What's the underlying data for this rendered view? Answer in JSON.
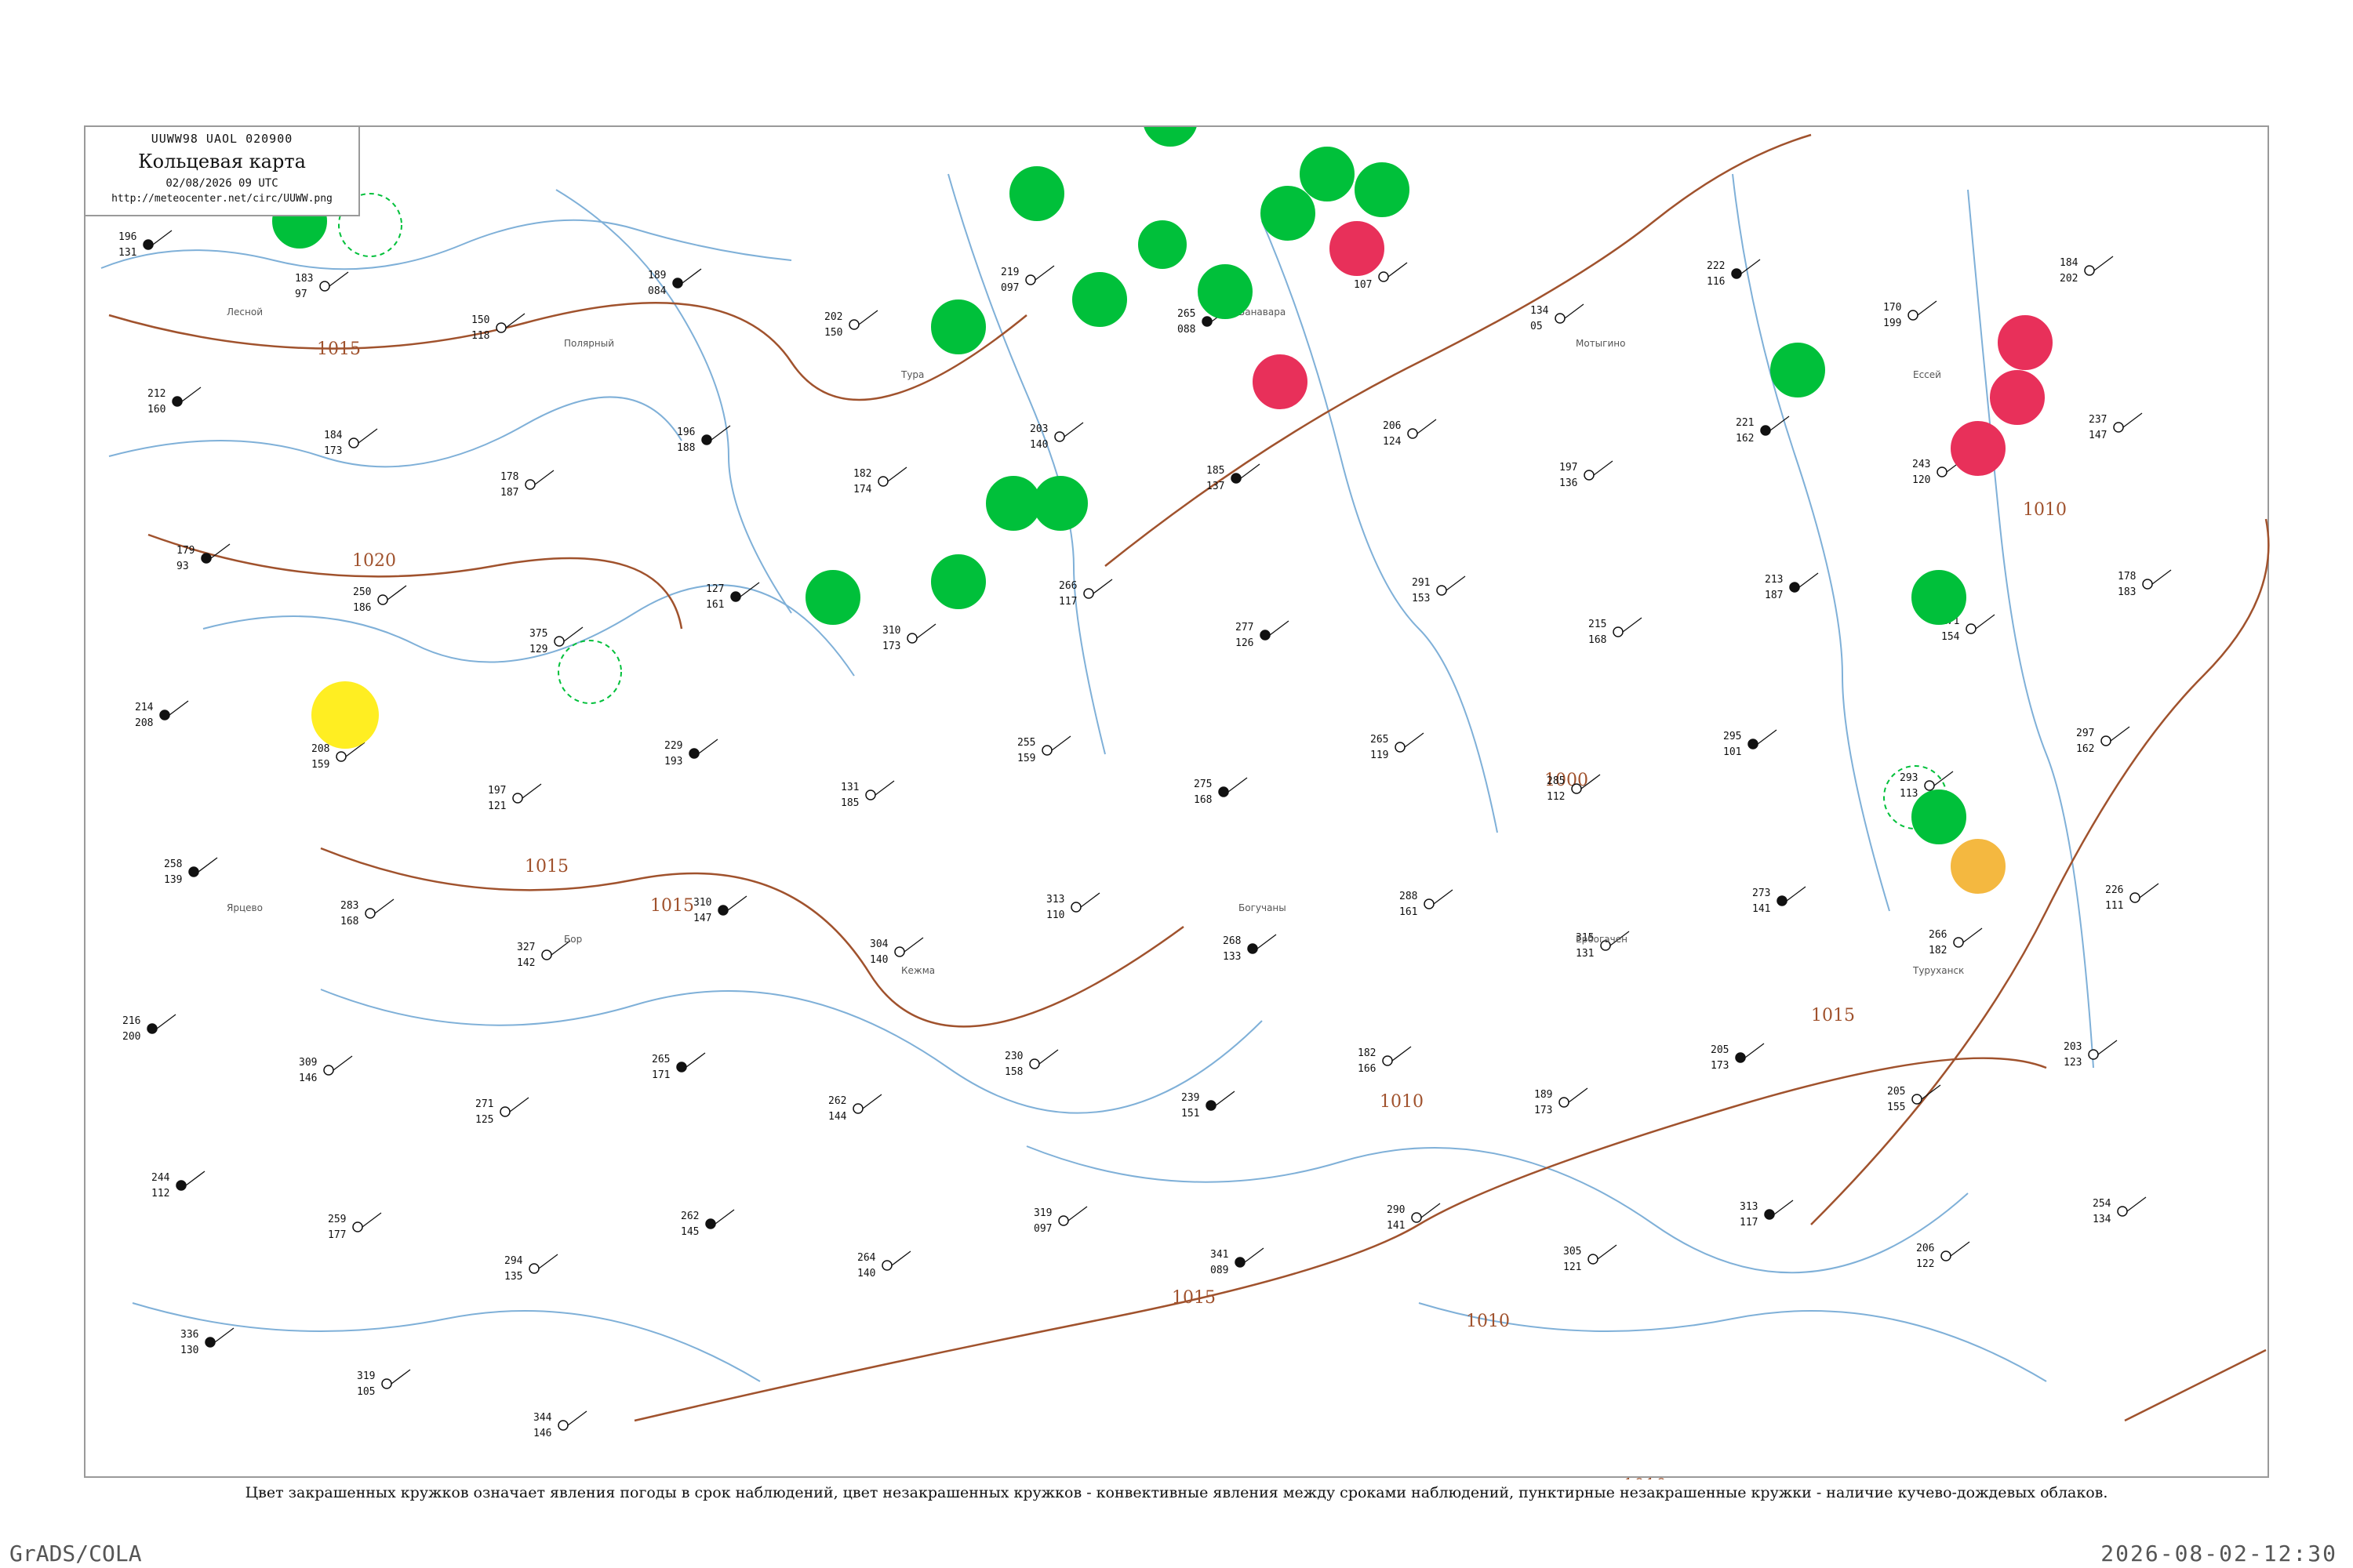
{
  "header": {
    "code": "UUWW98  UAOL  020900",
    "title": "Кольцевая карта",
    "date": "02/08/2026 09 UTC",
    "url": "http://meteocenter.net/circ/UUWW.png"
  },
  "isobars": [
    "1015",
    "1020",
    "1015",
    "1015",
    "1015",
    "1015",
    "1010",
    "1010",
    "1000",
    "1010",
    "1015",
    "1010",
    "1010"
  ],
  "colors": {
    "isobar": "#a0522d",
    "river": "#7fb0d8",
    "green_circle": "#00c03a",
    "red_circle": "#e8305a",
    "yellow_circle": "#ffee22",
    "orange_circle": "#f4b840"
  },
  "stations": [
    {
      "v1": "196",
      "v2": "131"
    },
    {
      "v1": "183",
      "v2": "97"
    },
    {
      "v1": "150",
      "v2": "118"
    },
    {
      "v1": "189",
      "v2": "084"
    },
    {
      "v1": "202",
      "v2": "150"
    },
    {
      "v1": "219",
      "v2": "097"
    },
    {
      "v1": "265",
      "v2": "088"
    },
    {
      "v1": "272",
      "v2": "107"
    },
    {
      "v1": "134",
      "v2": "05"
    },
    {
      "v1": "222",
      "v2": "116"
    },
    {
      "v1": "170",
      "v2": "199"
    },
    {
      "v1": "184",
      "v2": "202"
    },
    {
      "v1": "212",
      "v2": "160"
    },
    {
      "v1": "184",
      "v2": "173"
    },
    {
      "v1": "178",
      "v2": "187"
    },
    {
      "v1": "196",
      "v2": "188"
    },
    {
      "v1": "182",
      "v2": "174"
    },
    {
      "v1": "203",
      "v2": "140"
    },
    {
      "v1": "185",
      "v2": "137"
    },
    {
      "v1": "206",
      "v2": "124"
    },
    {
      "v1": "197",
      "v2": "136"
    },
    {
      "v1": "221",
      "v2": "162"
    },
    {
      "v1": "243",
      "v2": "120"
    },
    {
      "v1": "237",
      "v2": "147"
    },
    {
      "v1": "179",
      "v2": "93"
    },
    {
      "v1": "250",
      "v2": "186"
    },
    {
      "v1": "375",
      "v2": "129"
    },
    {
      "v1": "127",
      "v2": "161"
    },
    {
      "v1": "310",
      "v2": "173"
    },
    {
      "v1": "266",
      "v2": "117"
    },
    {
      "v1": "277",
      "v2": "126"
    },
    {
      "v1": "291",
      "v2": "153"
    },
    {
      "v1": "215",
      "v2": "168"
    },
    {
      "v1": "213",
      "v2": "187"
    },
    {
      "v1": "171",
      "v2": "154"
    },
    {
      "v1": "178",
      "v2": "183"
    },
    {
      "v1": "214",
      "v2": "208"
    },
    {
      "v1": "208",
      "v2": "159"
    },
    {
      "v1": "197",
      "v2": "121"
    },
    {
      "v1": "229",
      "v2": "193"
    },
    {
      "v1": "131",
      "v2": "185"
    },
    {
      "v1": "255",
      "v2": "159"
    },
    {
      "v1": "275",
      "v2": "168"
    },
    {
      "v1": "265",
      "v2": "119"
    },
    {
      "v1": "285",
      "v2": "112"
    },
    {
      "v1": "295",
      "v2": "101"
    },
    {
      "v1": "293",
      "v2": "113"
    },
    {
      "v1": "297",
      "v2": "162"
    },
    {
      "v1": "258",
      "v2": "139"
    },
    {
      "v1": "283",
      "v2": "168"
    },
    {
      "v1": "327",
      "v2": "142"
    },
    {
      "v1": "310",
      "v2": "147"
    },
    {
      "v1": "304",
      "v2": "140"
    },
    {
      "v1": "313",
      "v2": "110"
    },
    {
      "v1": "268",
      "v2": "133"
    },
    {
      "v1": "288",
      "v2": "161"
    },
    {
      "v1": "315",
      "v2": "131"
    },
    {
      "v1": "273",
      "v2": "141"
    },
    {
      "v1": "266",
      "v2": "182"
    },
    {
      "v1": "226",
      "v2": "111"
    },
    {
      "v1": "216",
      "v2": "200"
    },
    {
      "v1": "309",
      "v2": "146"
    },
    {
      "v1": "271",
      "v2": "125"
    },
    {
      "v1": "265",
      "v2": "171"
    },
    {
      "v1": "262",
      "v2": "144"
    },
    {
      "v1": "230",
      "v2": "158"
    },
    {
      "v1": "239",
      "v2": "151"
    },
    {
      "v1": "182",
      "v2": "166"
    },
    {
      "v1": "189",
      "v2": "173"
    },
    {
      "v1": "205",
      "v2": "173"
    },
    {
      "v1": "205",
      "v2": "155"
    },
    {
      "v1": "203",
      "v2": "123"
    },
    {
      "v1": "244",
      "v2": "112"
    },
    {
      "v1": "259",
      "v2": "177"
    },
    {
      "v1": "294",
      "v2": "135"
    },
    {
      "v1": "262",
      "v2": "145"
    },
    {
      "v1": "264",
      "v2": "140"
    },
    {
      "v1": "319",
      "v2": "097"
    },
    {
      "v1": "341",
      "v2": "089"
    },
    {
      "v1": "290",
      "v2": "141"
    },
    {
      "v1": "305",
      "v2": "121"
    },
    {
      "v1": "313",
      "v2": "117"
    },
    {
      "v1": "206",
      "v2": "122"
    },
    {
      "v1": "254",
      "v2": "134"
    },
    {
      "v1": "336",
      "v2": "130"
    },
    {
      "v1": "319",
      "v2": "105"
    },
    {
      "v1": "344",
      "v2": "146"
    }
  ],
  "labels": [
    {
      "text": "Лесной"
    },
    {
      "text": "Полярный"
    },
    {
      "text": "Тура"
    },
    {
      "text": "Ванавара"
    },
    {
      "text": "Мотыгино"
    },
    {
      "text": "Ессей"
    },
    {
      "text": "Ярцево"
    },
    {
      "text": "Бор"
    },
    {
      "text": "Кежма"
    },
    {
      "text": "Богучаны"
    },
    {
      "text": "Ербогачен"
    },
    {
      "text": "Туруханск"
    }
  ],
  "legend": "Цвет закрашенных кружков означает явления погоды в срок наблюдений, цвет незакрашенных кружков - конвективные явления между сроками наблюдений, пунктирные незакрашенные кружки - наличие кучево-дождевых облаков.",
  "footer": {
    "left": "GrADS/COLA",
    "right": "2026-08-02-12:30"
  }
}
